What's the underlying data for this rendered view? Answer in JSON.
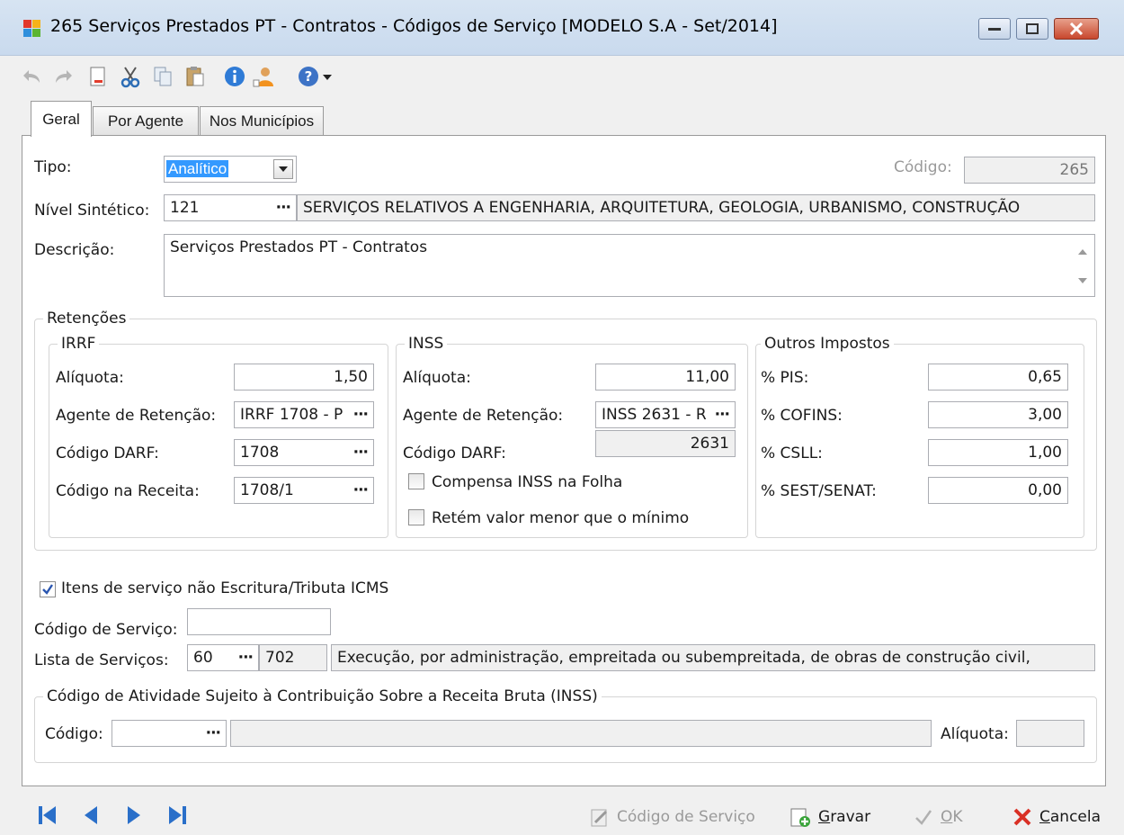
{
  "window": {
    "title": "265 Serviços Prestados PT - Contratos -  Códigos de Serviço [MODELO S.A - Set/2014]"
  },
  "tabs": [
    {
      "label": "Geral"
    },
    {
      "label": "Por Agente"
    },
    {
      "label": "Nos Municípios"
    }
  ],
  "form": {
    "tipo_label": "Tipo:",
    "tipo_value": "Analítico",
    "codigo_label": "Código:",
    "codigo_value": "265",
    "nivel_label": "Nível Sintético:",
    "nivel_value": "121",
    "nivel_desc": "SERVIÇOS RELATIVOS A ENGENHARIA, ARQUITETURA, GEOLOGIA, URBANISMO, CONSTRUÇÃO",
    "descricao_label": "Descrição:",
    "descricao_value": "Serviços Prestados PT - Contratos"
  },
  "retencoes": {
    "title": "Retenções",
    "irrf": {
      "title": "IRRF",
      "aliquota_label": "Alíquota:",
      "aliquota_value": "1,50",
      "agente_label": "Agente de Retenção:",
      "agente_value": "IRRF 1708 - P",
      "darf_label": "Código DARF:",
      "darf_value": "1708",
      "receita_label": "Código na Receita:",
      "receita_value": "1708/1"
    },
    "inss": {
      "title": "INSS",
      "aliquota_label": "Alíquota:",
      "aliquota_value": "11,00",
      "agente_label": "Agente de Retenção:",
      "agente_value": "INSS 2631 - R",
      "darf_label": "Código DARF:",
      "darf_value": "2631",
      "compensa_label": "Compensa INSS na Folha",
      "retem_label": "Retém valor menor que o mínimo"
    },
    "outros": {
      "title": "Outros Impostos",
      "pis_label": "% PIS:",
      "pis_value": "0,65",
      "cofins_label": "% COFINS:",
      "cofins_value": "3,00",
      "csll_label": "% CSLL:",
      "csll_value": "1,00",
      "sest_label": "% SEST/SENAT:",
      "sest_value": "0,00"
    }
  },
  "itens_label": "Itens de serviço não Escritura/Tributa ICMS",
  "codigo_servico_label": "Código de Serviço:",
  "codigo_servico_value": "",
  "lista_label": "Lista de Serviços:",
  "lista_value": "60",
  "lista_code": "702",
  "lista_desc": "Execução, por administração, empreitada ou subempreitada, de obras de construção civil,",
  "atividade": {
    "title": "Código de Atividade Sujeito à Contribuição Sobre a Receita Bruta (INSS)",
    "codigo_label": "Código:",
    "aliquota_label": "Alíquota:"
  },
  "bottom": {
    "codigo_servico": "Código de Serviço",
    "gravar_prefix": "",
    "gravar_u": "G",
    "gravar_rest": "ravar",
    "ok_u": "O",
    "ok_rest": "K",
    "cancela_u": "C",
    "cancela_rest": "ancela"
  },
  "colors": {
    "selection": "#3399ff",
    "cancel_red": "#d93025",
    "nav_blue": "#2a6fc9"
  }
}
